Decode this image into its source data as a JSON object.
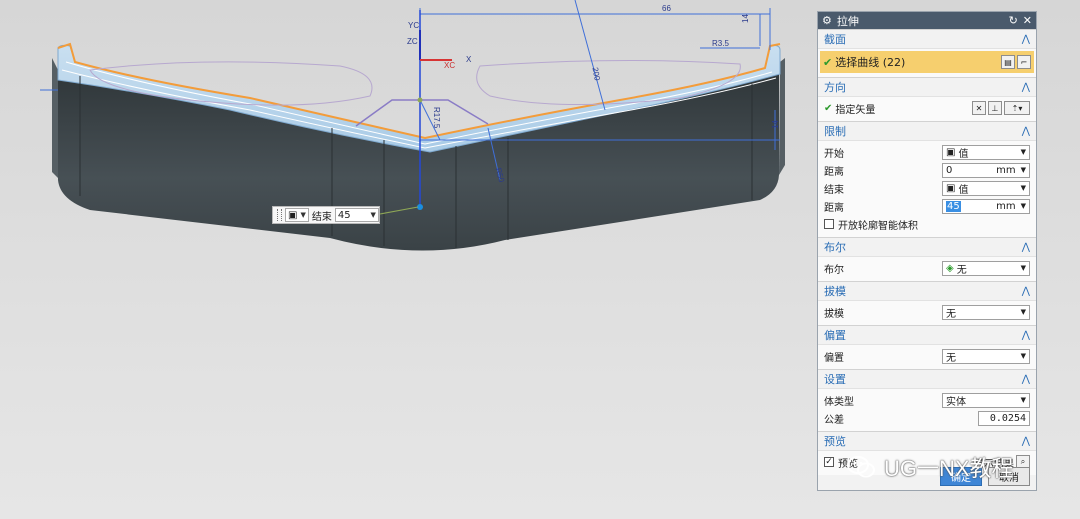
{
  "viewport": {
    "axis_labels": {
      "yc": "YC",
      "zc": "ZC",
      "xc": "XC",
      "x": "X"
    },
    "dimensions": [
      "66",
      "14",
      "R3.5",
      "200",
      "R17.5",
      "R50",
      "14"
    ],
    "floating_control": {
      "label": "结束",
      "value": "45"
    }
  },
  "dialog": {
    "title": "拉伸",
    "sections": {
      "section": {
        "title": "截面",
        "select_curve": "选择曲线 (22)"
      },
      "direction": {
        "title": "方向",
        "specify_vector": "指定矢量"
      },
      "limits": {
        "title": "限制",
        "start_label": "开始",
        "start_value": "值",
        "start_distance_label": "距离",
        "start_distance": "0",
        "start_unit": "mm",
        "end_label": "结束",
        "end_value": "值",
        "end_distance_label": "距离",
        "end_distance": "45",
        "end_unit": "mm",
        "open_profile": "开放轮廓智能体积"
      },
      "boolean": {
        "title": "布尔",
        "label": "布尔",
        "value": "无"
      },
      "draft": {
        "title": "拔模",
        "label": "拔模",
        "value": "无"
      },
      "offset": {
        "title": "偏置",
        "label": "偏置",
        "value": "无"
      },
      "settings": {
        "title": "设置",
        "body_type_label": "体类型",
        "body_type": "实体",
        "tolerance_label": "公差",
        "tolerance": "0.0254"
      },
      "preview": {
        "title": "预览",
        "preview_label": "预览",
        "show_result": "显示结果"
      }
    },
    "buttons": {
      "ok": "确定",
      "cancel": "取消"
    }
  },
  "watermark": {
    "text": "UG一NX教程"
  },
  "colors": {
    "accent": "#2a6db5",
    "titlebar": "#4a5a6c",
    "highlight": "#f6cf6e",
    "body": "#3e474c",
    "edge": "#f39c3a"
  }
}
